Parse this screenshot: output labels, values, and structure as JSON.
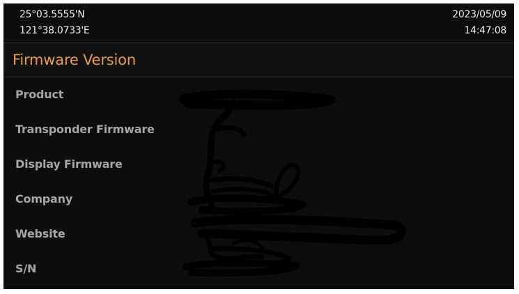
{
  "status_bar": {
    "latitude": "25°03.5555'N",
    "longitude": "121°38.0733'E",
    "date": "2023/05/09",
    "time": "14:47:08"
  },
  "page": {
    "title": "Firmware Version"
  },
  "info": [
    {
      "label": "Product",
      "value": ""
    },
    {
      "label": "Transponder Firmware",
      "value": ""
    },
    {
      "label": "Display Firmware",
      "value": ""
    },
    {
      "label": "Company",
      "value": ""
    },
    {
      "label": "Website",
      "value": ""
    },
    {
      "label": "S/N",
      "value": ""
    }
  ],
  "colors": {
    "background": "#0d0d0d",
    "title": "#e89a4b",
    "label": "#a6a6a6",
    "text": "#ededed"
  }
}
